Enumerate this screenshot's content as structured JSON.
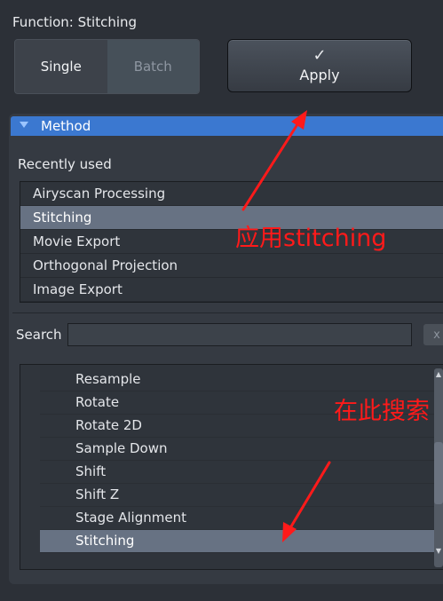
{
  "function_label": "Function:  Stitching",
  "mode_toggle": {
    "single": "Single",
    "batch": "Batch",
    "selected": "Single"
  },
  "apply": {
    "check": "✓",
    "label": "Apply"
  },
  "method": {
    "title": "Method"
  },
  "recently_used": {
    "label": "Recently used",
    "items": [
      "Airyscan Processing",
      "Stitching",
      "Movie Export",
      "Orthogonal Projection",
      "Image Export"
    ],
    "selected": "Stitching"
  },
  "search": {
    "label": "Search",
    "value": "",
    "clear": "x"
  },
  "function_list": {
    "items": [
      "Resample",
      "Rotate",
      "Rotate 2D",
      "Sample Down",
      "Shift",
      "Shift Z",
      "Stage Alignment",
      "Stitching"
    ],
    "selected": "Stitching"
  },
  "annotations": {
    "apply_note": "应用stitching",
    "search_note": "在此搜索"
  },
  "colors": {
    "accent": "#3b78d0",
    "annotation": "#ff1a1a",
    "selected_row": "#677283"
  }
}
